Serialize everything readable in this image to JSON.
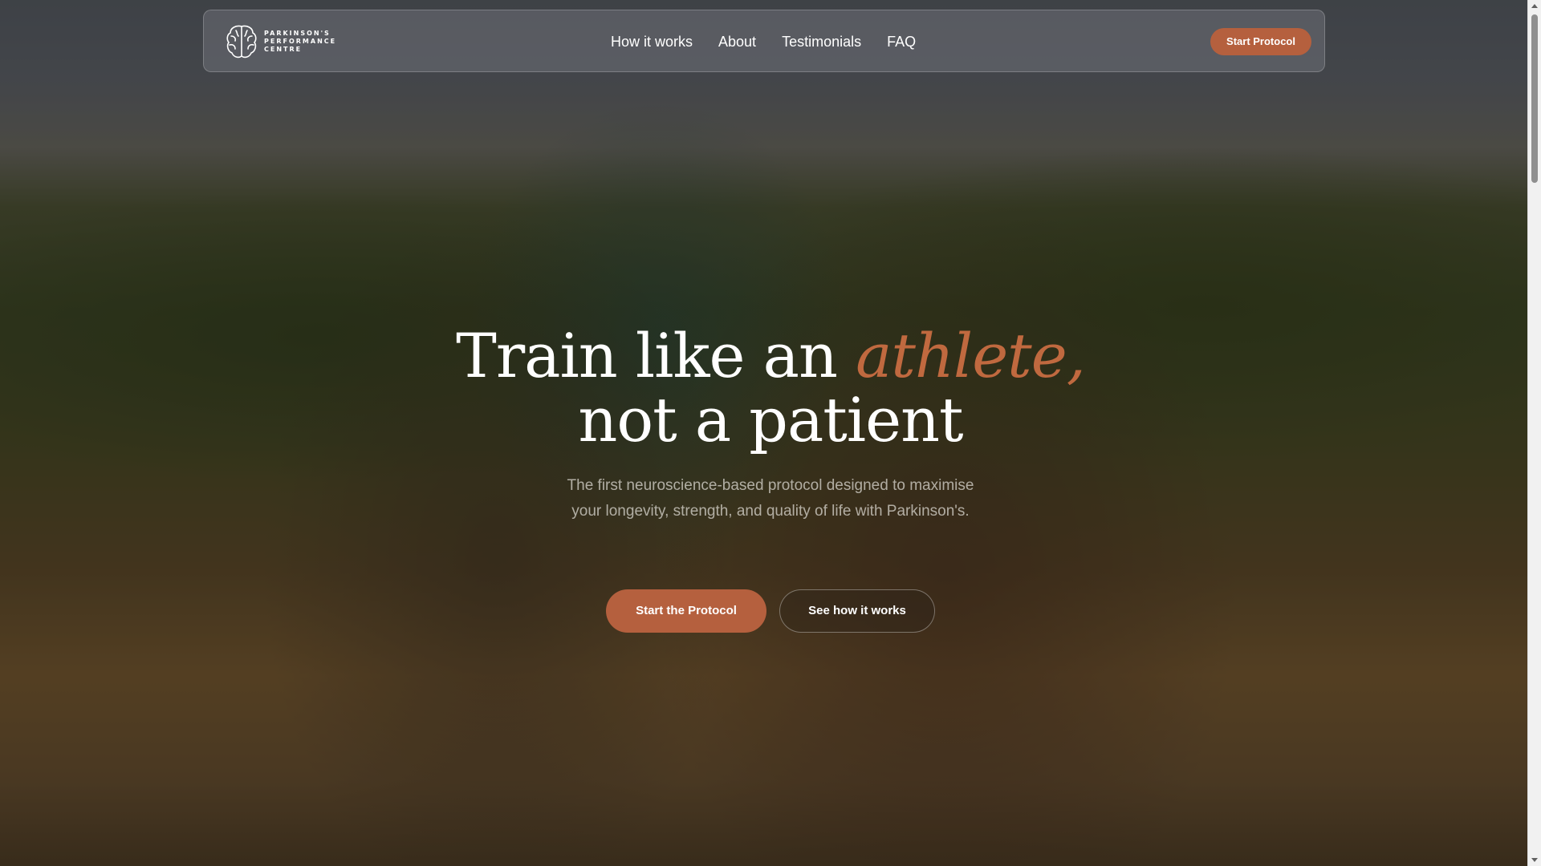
{
  "brand": {
    "logo_icon": "brain-icon",
    "name_line1": "PARKINSON'S",
    "name_line2": "PERFORMANCE",
    "name_line3": "CENTRE"
  },
  "nav": {
    "links": [
      "How it works",
      "About",
      "Testimonials",
      "FAQ"
    ],
    "cta_label": "Start Protocol"
  },
  "hero": {
    "headline_part1": "Train like an ",
    "headline_accent": "athlete,",
    "headline_line2": "not a patient",
    "subtitle": "The first neuroscience-based protocol designed to maximise your longevity, strength, and quality of life with Parkinson's.",
    "primary_cta": "Start the Protocol",
    "secondary_cta": "See how it works"
  },
  "colors": {
    "accent": "#c0693f",
    "button": "#b5603e"
  }
}
